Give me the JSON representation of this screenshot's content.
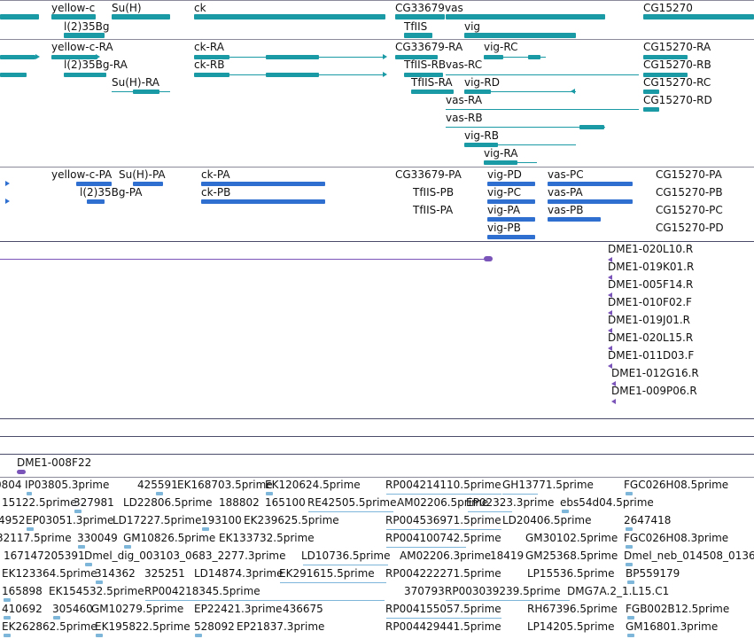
{
  "colors": {
    "gene": "#1a9aa5",
    "transcript": "#1a9aa5",
    "protein": "#2f6fd0",
    "clone": "#7a54b8",
    "est": "#7db6d9",
    "divider": "#8a8a9a"
  },
  "gene_track": {
    "labels": [
      "yellow-c",
      "Su(H)",
      "ck",
      "CG33679",
      "vas",
      "CG15270",
      "l(2)35Bg",
      "TfIIS",
      "vig"
    ]
  },
  "transcript_track": {
    "labels": [
      "yellow-c-RA",
      "ck-RA",
      "CG33679-RA",
      "vig-RC",
      "CG15270-RA",
      "l(2)35Bg-RA",
      "ck-RB",
      "TfIIS-RB",
      "vas-RC",
      "CG15270-RB",
      "Su(H)-RA",
      "TfIIS-RA",
      "vig-RD",
      "CG15270-RC",
      "vas-RA",
      "CG15270-RD",
      "vas-RB",
      "vig-RB",
      "vig-RA"
    ]
  },
  "protein_track": {
    "labels": [
      "yellow-c-PA",
      "Su(H)-PA",
      "ck-PA",
      "CG33679-PA",
      "vig-PD",
      "vas-PC",
      "CG15270-PA",
      "l(2)35Bg-PA",
      "ck-PB",
      "TfIIS-PB",
      "vig-PC",
      "vas-PA",
      "CG15270-PB",
      "TfIIS-PA",
      "vig-PA",
      "vas-PB",
      "CG15270-PC",
      "vig-PB",
      "CG15270-PD"
    ]
  },
  "clone_track": {
    "labels": [
      "DME1-020L10.R",
      "DME1-019K01.R",
      "DME1-005F14.R",
      "DME1-010F02.F",
      "DME1-019J01.R",
      "DME1-020L15.R",
      "DME1-011D03.F",
      "DME1-012G16.R",
      "DME1-009P06.R"
    ]
  },
  "clone_track2": {
    "labels": [
      "DME1-008F22"
    ]
  },
  "est_track": {
    "rows": [
      [
        "0804",
        "IP03805.3prime",
        "425591",
        "EK168703.5prime",
        "EK120624.5prime",
        "RP004214110.5prime",
        "GH13771.5prime",
        "FGC026H08.5prime"
      ],
      [
        "15122.5prime",
        "327981",
        "LD22806.5prime",
        "188802",
        "165100",
        "RE42505.5prime",
        "AM02206.5prime",
        "EP02323.3prime",
        "ebs54d04.5prime"
      ],
      [
        "4952",
        "EP03051.3prime",
        "LD17227.5prime",
        "193100",
        "EK239625.5prime",
        "RP004536971.5prime",
        "LD20406.5prime",
        "2647418"
      ],
      [
        "32117.5prime",
        "330049",
        "GM10826.5prime",
        "EK133732.5prime",
        "RP004100742.5prime",
        "GM30102.5prime",
        "FGC026H08.3prime"
      ],
      [
        "167147205391",
        "Dmel_dig_003103_0683_2277.3prime",
        "LD10736.5prime",
        "AM02206.3prime",
        "18419",
        "GM25368.5prime",
        "Dmel_neb_014508_0136"
      ],
      [
        "EK123364.5prime",
        "314362",
        "325251",
        "LD14874.3prime",
        "EK291615.5prime",
        "RP004222271.5prime",
        "LP15536.5prime",
        "BP559179"
      ],
      [
        "165898",
        "EK154532.5prime",
        "RP004218345.5prime",
        "370793",
        "RP003039239.5prime",
        "DMG7A.2_1.L15.C1"
      ],
      [
        "410692",
        "305460",
        "GM10279.5prime",
        "EP22421.3prime",
        "436675",
        "RP004155057.5prime",
        "RH67396.5prime",
        "FGB002B12.5prime"
      ],
      [
        "EK262862.5prime",
        "EK195822.5prime",
        "528092",
        "EP21837.3prime",
        "RP004429441.5prime",
        "LP14205.5prime",
        "GM16801.3prime"
      ]
    ]
  }
}
